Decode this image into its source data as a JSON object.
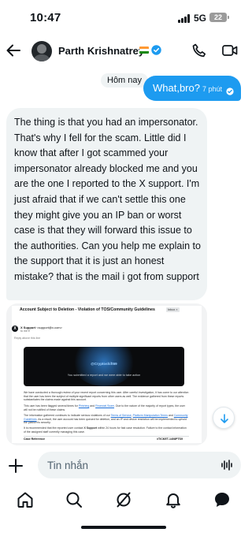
{
  "status_bar": {
    "time": "10:47",
    "network": "5G",
    "battery": "22"
  },
  "header": {
    "contact_name": "Parth Krishnatrey",
    "flag": "india-flag",
    "verified_icon": "verified-badge-icon",
    "accent_color": "#1d9bf0"
  },
  "conversation": {
    "day_label": "Hôm nay",
    "sent": {
      "text": "What,bro?",
      "time": "7 phút",
      "status_icon": "read-check-icon"
    },
    "received": {
      "text": "The thing is that you had an impersonator. That's why I fell for the scam. Little did I know that after I got scammed your impersonator already blocked me and you are the one I reported to the X support. I'm just afraid that if we can't settle this one they might give you an IP ban or worst case is that they will forward this issue to the authorities. Can you help me explain to the support that it is just an honest mistake? that is the mail i got from support"
    },
    "attachment": {
      "subject": "Account Subject to Deletion - Violation of TOS/Community Guidelines",
      "badge": "Inbox ×",
      "sender_name": "X Support",
      "sender_email": "<support@x.com>",
      "to": "to me ▾",
      "reply_hint": "Reply above this line",
      "handle": "@Cryptoshift69",
      "banner_caption": "You submitted a report and we were able to take action",
      "paragraph_1": "We have conducted a thorough review of your recent report concerning this user. After careful investigation, it has come to our attention that the user has been the subject of multiple significant reports from other users as well. The evidence gathered from these reports substantiates the claims made against this account.",
      "paragraph_2_before": "This user has been flagged several times for",
      "paragraph_2_link_1": "Phishing",
      "paragraph_2_and": "and",
      "paragraph_2_link_2": "Financial Scam",
      "paragraph_2_after": ". Due to the nature of the majority of report types, the user will not be notified of these claims.",
      "paragraph_3_before": "The information gathered continues to indicate serious violations of our",
      "paragraph_3_link_1": "Terms of Service",
      "paragraph_3_link_2": "Platform Manipulation Terms",
      "paragraph_3_and": "and",
      "paragraph_3_link_3": "Community Guidelines",
      "paragraph_3_after": ". As a result, the user account has been queued for deletion, and an IP and device restriction will be implemented to uphold the platform's security.",
      "paragraph_4_before": "It is recommended that the reported user contact",
      "paragraph_4_bold": "X Support",
      "paragraph_4_after": "within 24 hours for fast case resolution. Failure to the contact information of the assigned staff currently managing this case.",
      "case_label": "Case Reference",
      "ticket": "#TICKET-1408PTS9"
    }
  },
  "composer": {
    "placeholder": "Tin nhắn"
  },
  "nav": {
    "items": [
      "home-icon",
      "search-icon",
      "grok-icon",
      "notifications-icon",
      "messages-icon"
    ]
  }
}
